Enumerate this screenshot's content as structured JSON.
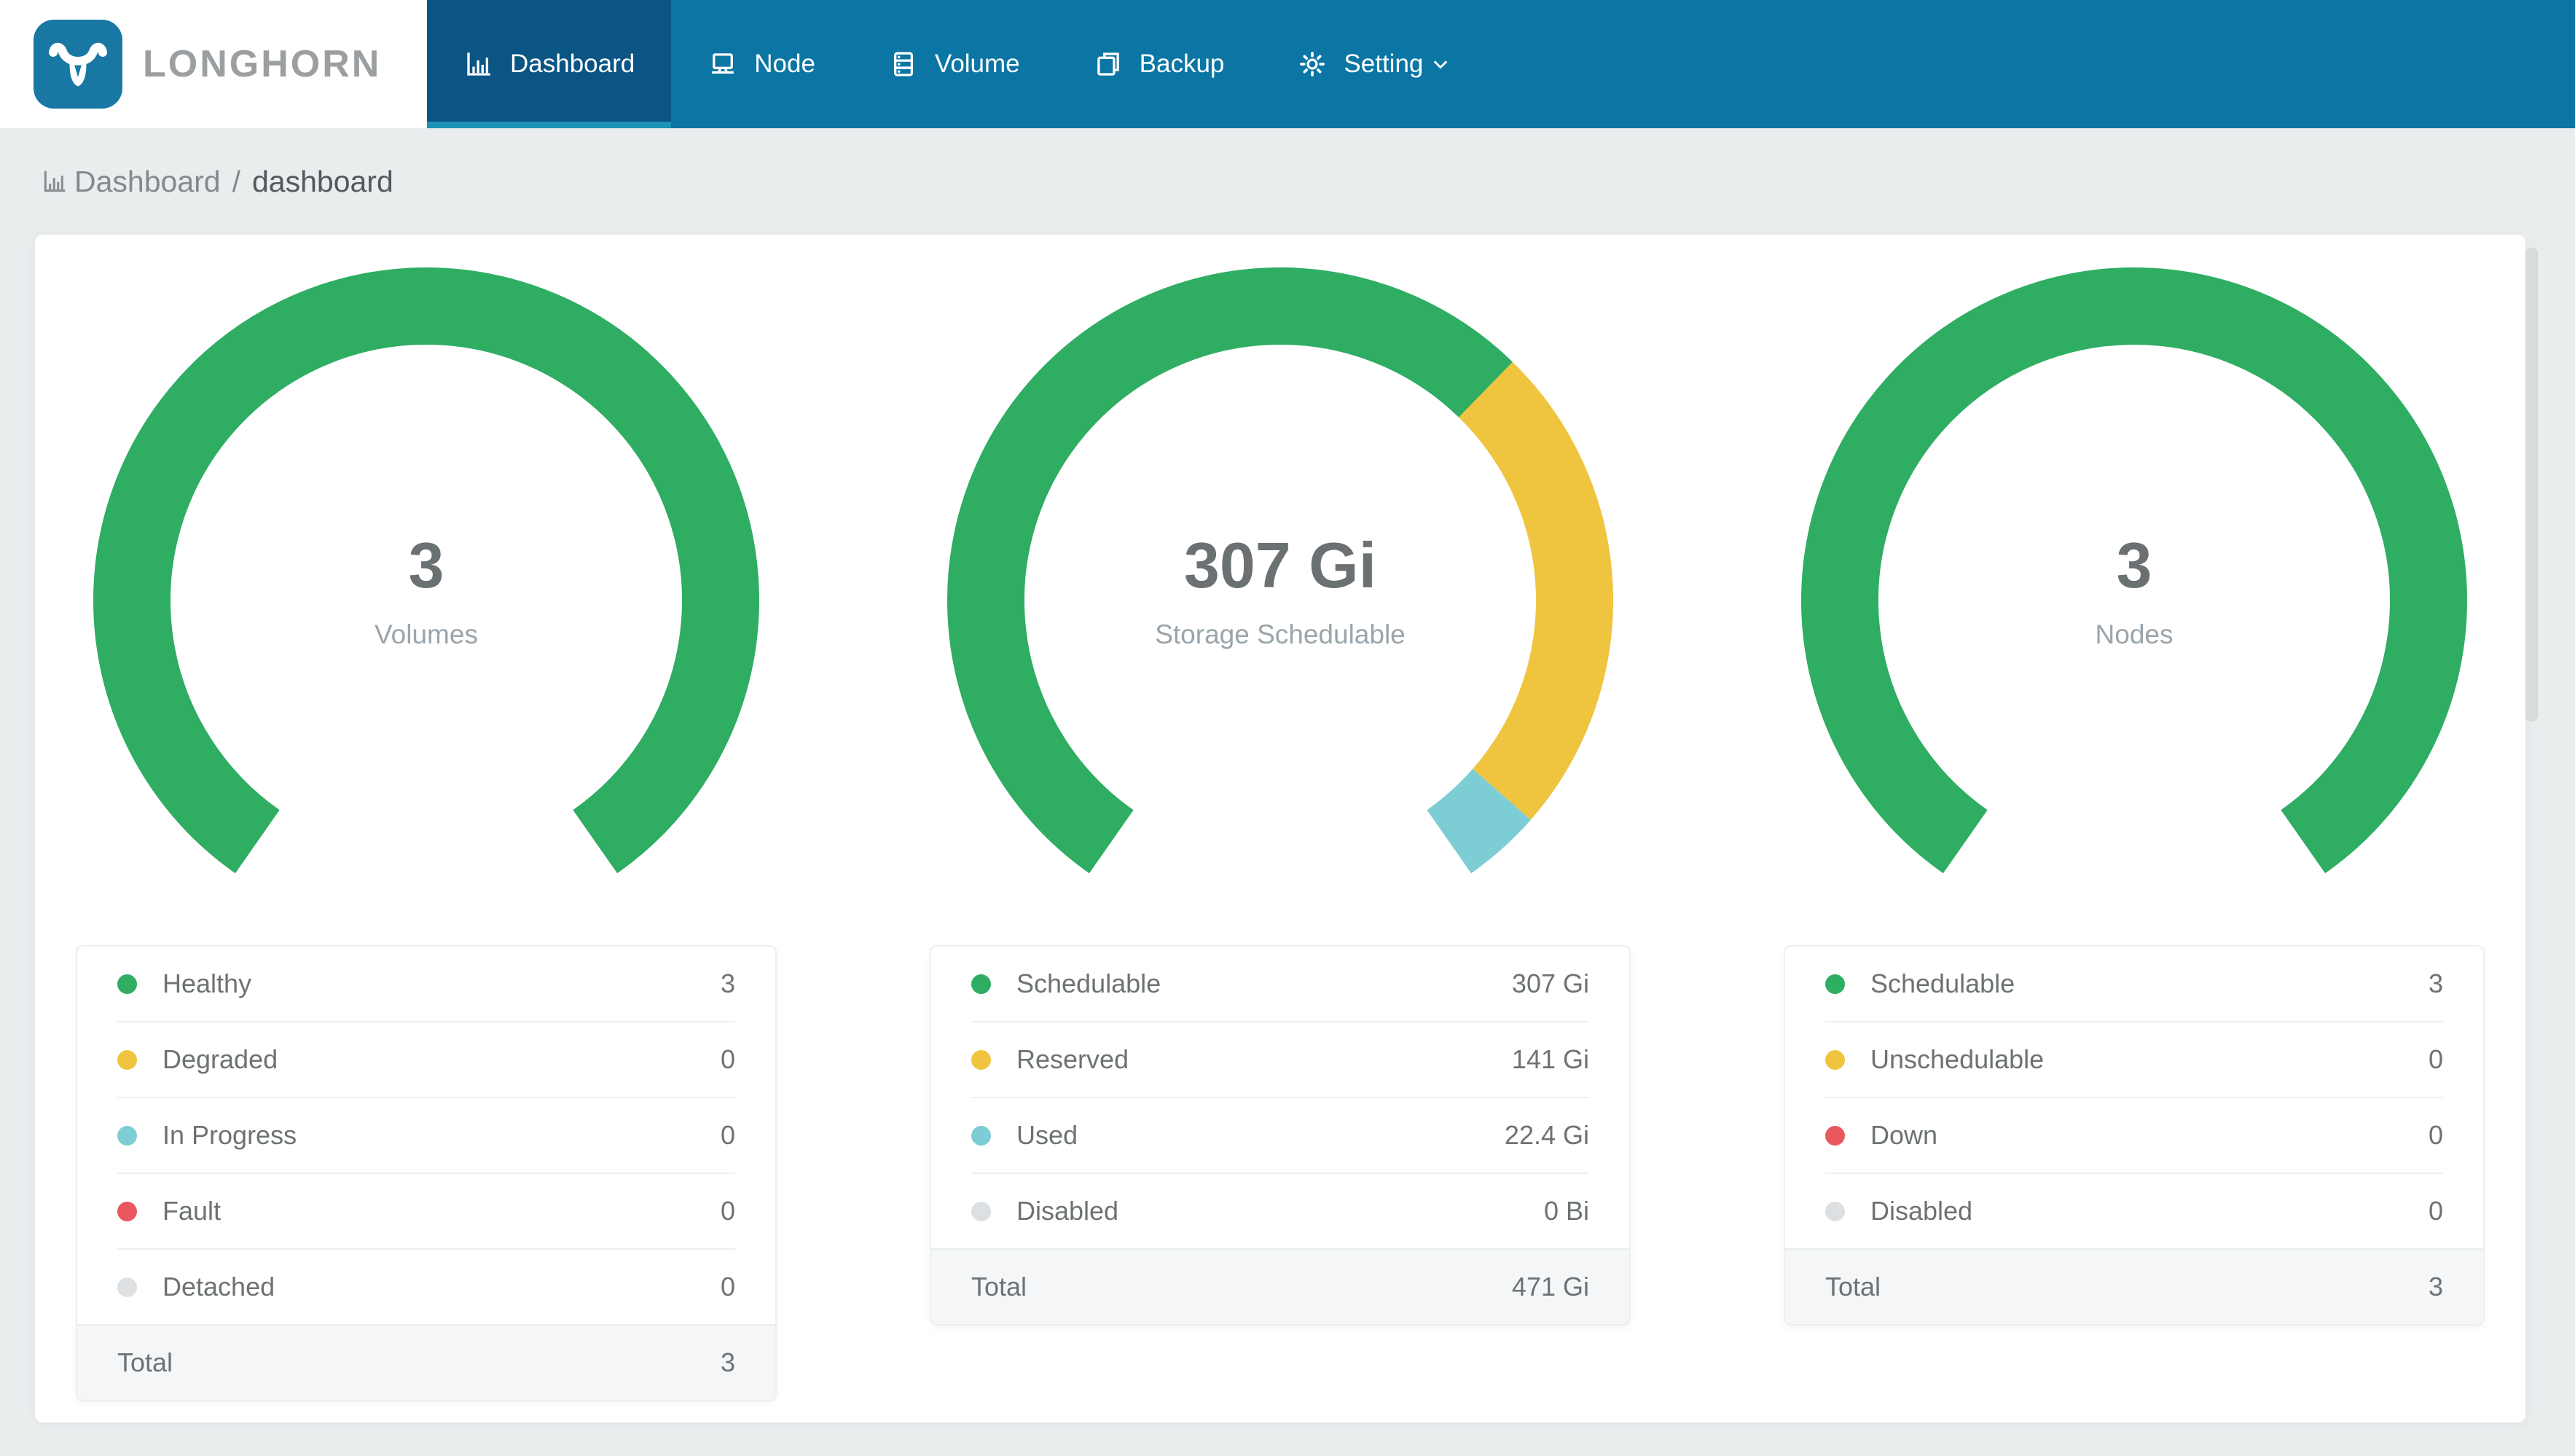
{
  "brand": {
    "name": "LONGHORN",
    "logo_color": "#1878a3",
    "nav_bg": "#0b76a4",
    "nav_active_bg": "#0a5584",
    "nav_active_underline": "#1e93b8"
  },
  "nav": {
    "items": [
      {
        "id": "dashboard",
        "label": "Dashboard",
        "icon": "bar-chart-icon",
        "active": true,
        "has_dropdown": false
      },
      {
        "id": "node",
        "label": "Node",
        "icon": "laptop-icon",
        "active": false,
        "has_dropdown": false
      },
      {
        "id": "volume",
        "label": "Volume",
        "icon": "server-icon",
        "active": false,
        "has_dropdown": false
      },
      {
        "id": "backup",
        "label": "Backup",
        "icon": "document-icon",
        "active": false,
        "has_dropdown": false
      },
      {
        "id": "setting",
        "label": "Setting",
        "icon": "gear-icon",
        "active": false,
        "has_dropdown": true
      }
    ]
  },
  "breadcrumb": {
    "icon": "bar-chart-icon",
    "section": "Dashboard",
    "separator": "/",
    "page": "dashboard"
  },
  "chart_data": [
    {
      "type": "gauge",
      "name": "volumes",
      "center_value": "3",
      "center_label": "Volumes",
      "arc_total_degrees": 290,
      "arc_start_degrees": 215,
      "segments": [
        {
          "label": "Healthy",
          "value": 3,
          "display": "3",
          "color": "#2ead63"
        },
        {
          "label": "Degraded",
          "value": 0,
          "display": "0",
          "color": "#efc53f"
        },
        {
          "label": "In Progress",
          "value": 0,
          "display": "0",
          "color": "#7dcdd4"
        },
        {
          "label": "Fault",
          "value": 0,
          "display": "0",
          "color": "#e9575f"
        },
        {
          "label": "Detached",
          "value": 0,
          "display": "0",
          "color": "#dee1e4"
        }
      ],
      "total_label": "Total",
      "total_value": "3"
    },
    {
      "type": "gauge",
      "name": "storage-schedulable",
      "center_value": "307 Gi",
      "center_label": "Storage Schedulable",
      "arc_total_degrees": 290,
      "arc_start_degrees": 215,
      "segments": [
        {
          "label": "Schedulable",
          "value": 307,
          "display": "307 Gi",
          "color": "#2ead63"
        },
        {
          "label": "Reserved",
          "value": 141,
          "display": "141 Gi",
          "color": "#efc53f"
        },
        {
          "label": "Used",
          "value": 22.4,
          "display": "22.4 Gi",
          "color": "#7dcdd4"
        },
        {
          "label": "Disabled",
          "value": 0,
          "display": "0 Bi",
          "color": "#dce0e3"
        }
      ],
      "total_label": "Total",
      "total_value": "471 Gi"
    },
    {
      "type": "gauge",
      "name": "nodes",
      "center_value": "3",
      "center_label": "Nodes",
      "arc_total_degrees": 290,
      "arc_start_degrees": 215,
      "segments": [
        {
          "label": "Schedulable",
          "value": 3,
          "display": "3",
          "color": "#2ead63"
        },
        {
          "label": "Unschedulable",
          "value": 0,
          "display": "0",
          "color": "#efc53f"
        },
        {
          "label": "Down",
          "value": 0,
          "display": "0",
          "color": "#e9575f"
        },
        {
          "label": "Disabled",
          "value": 0,
          "display": "0",
          "color": "#dce0e3"
        }
      ],
      "total_label": "Total",
      "total_value": "3"
    }
  ]
}
